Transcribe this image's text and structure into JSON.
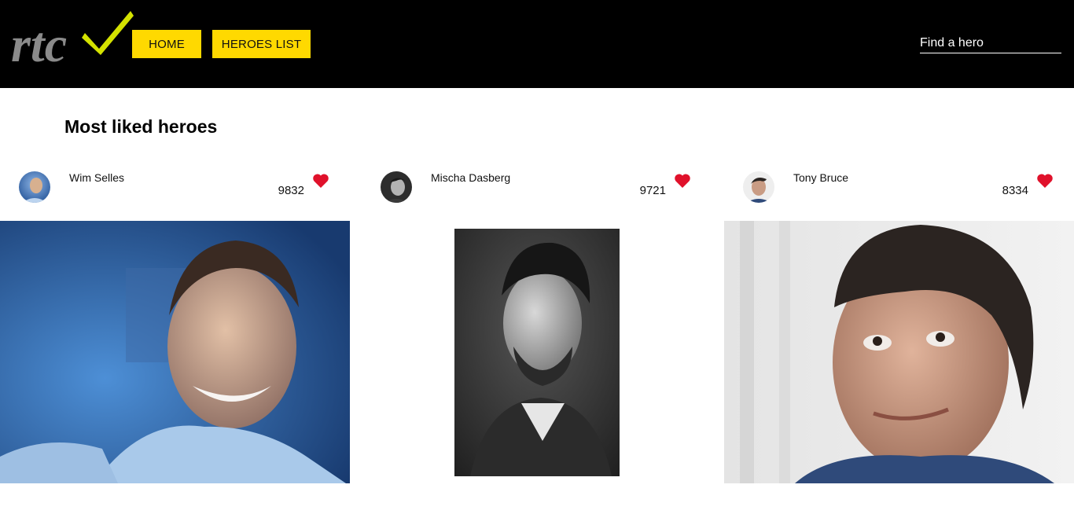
{
  "header": {
    "logo_text": "rtc",
    "nav": [
      {
        "label": "HOME"
      },
      {
        "label": "HEROES LIST"
      }
    ],
    "search": {
      "placeholder": "Find a hero",
      "value": ""
    }
  },
  "main": {
    "title": "Most liked heroes",
    "heroes": [
      {
        "name": "Wim Selles",
        "likes": "9832"
      },
      {
        "name": "Mischa Dasberg",
        "likes": "9721"
      },
      {
        "name": "Tony Bruce",
        "likes": "8334"
      }
    ]
  },
  "colors": {
    "topbar": "#000000",
    "accent_yellow": "#ffd900",
    "logo_check": "#d4e200",
    "heart": "#e0112b"
  },
  "icons": {
    "like": "heart-icon",
    "logo": "checkmark-logo"
  }
}
